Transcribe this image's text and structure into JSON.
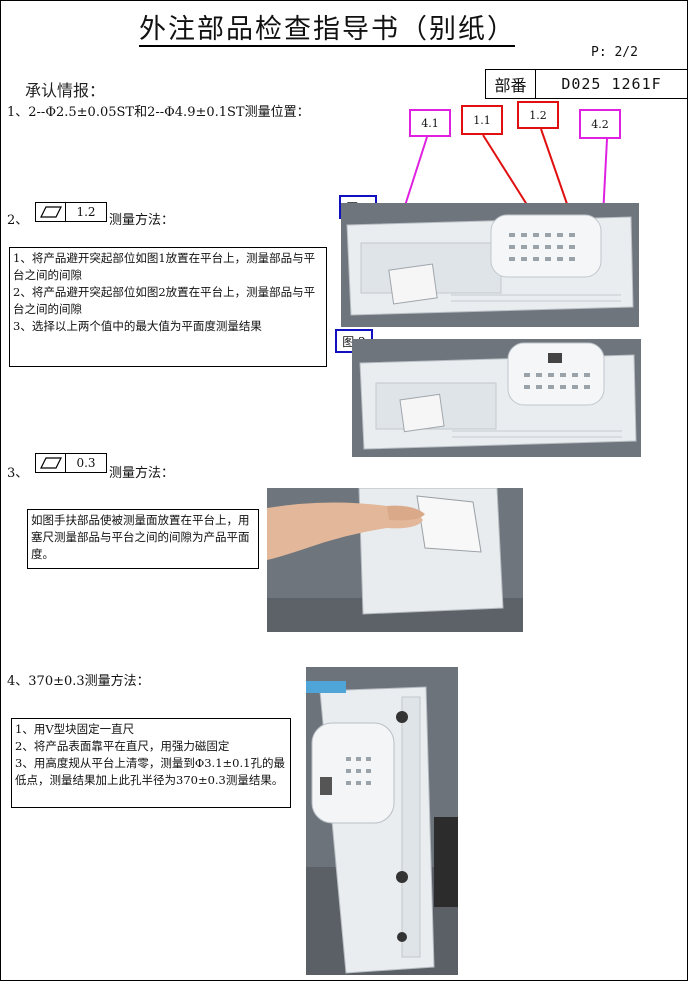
{
  "header": {
    "title": "外注部品检查指导书（别纸）",
    "page_no": "P: 2/2",
    "approval_label": "承认情报：",
    "part_no_label": "部番",
    "part_no_value": "D025 1261F"
  },
  "section1": {
    "text": "1、2--Φ2.5±0.05ST和2--Φ4.9±0.1ST测量位置："
  },
  "section2": {
    "prefix": "2、",
    "flatness_value": "1.2",
    "method": "测量方法：",
    "instructions": [
      "1、将产品避开突起部位如图1放置在平台上，测量部品与平台之间的间隙",
      "2、将产品避开突起部位如图2放置在平台上，测量部品与平台之间的间隙",
      "3、选择以上两个值中的最大值为平面度测量结果"
    ]
  },
  "section3": {
    "prefix": "3、",
    "flatness_value": "0.3",
    "method": "测量方法：",
    "instructions": "如图手扶部品使被测量面放置在平台上，用塞尺测量部品与平台之间的间隙为产品平面度。"
  },
  "section4": {
    "text": "4、370±0.3测量方法：",
    "instructions": [
      "1、用V型块固定一直尺",
      "2、将产品表面靠平在直尺，用强力磁固定",
      "3、用高度规从平台上清零，测量到Φ3.1±0.1孔的最低点，测量结果加上此孔半径为370±0.3测量结果。"
    ]
  },
  "callouts": {
    "c41": "4.1",
    "c11": "1.1",
    "c12": "1.2",
    "c42": "4.2"
  },
  "figures": {
    "fig1": "图 1",
    "fig2": "图 2"
  },
  "colors": {
    "callout_magenta": "#e020e0",
    "callout_red": "#e01010",
    "figure_label_blue": "#1010c0"
  }
}
